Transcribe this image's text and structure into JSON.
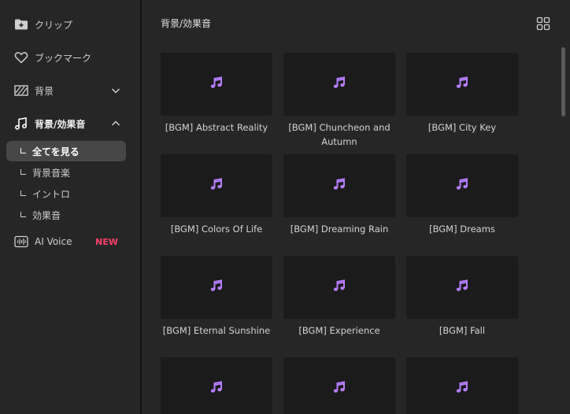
{
  "sidebar": {
    "items": [
      {
        "label": "クリップ",
        "icon": "folder-plus-icon"
      },
      {
        "label": "ブックマーク",
        "icon": "heart-icon"
      },
      {
        "label": "背景",
        "icon": "stripes-icon"
      },
      {
        "label": "背景/効果音",
        "icon": "music-note-icon"
      }
    ],
    "subitems": [
      {
        "label": "全てを見る",
        "active": true
      },
      {
        "label": "背景音楽",
        "active": false
      },
      {
        "label": "イントロ",
        "active": false
      },
      {
        "label": "効果音",
        "active": false
      }
    ],
    "ai_voice": {
      "label": "AI Voice",
      "badge": "NEW",
      "icon": "waveform-icon"
    }
  },
  "main": {
    "title": "背景/効果音",
    "cards": [
      {
        "label": "[BGM] Abstract Reality"
      },
      {
        "label": "[BGM] Chuncheon and Autumn"
      },
      {
        "label": "[BGM] City Key"
      },
      {
        "label": "[BGM] Colors Of Life"
      },
      {
        "label": "[BGM] Dreaming Rain"
      },
      {
        "label": "[BGM] Dreams"
      },
      {
        "label": "[BGM] Eternal Sunshine"
      },
      {
        "label": "[BGM] Experience"
      },
      {
        "label": "[BGM] Fall"
      },
      {
        "label": ""
      },
      {
        "label": ""
      },
      {
        "label": ""
      }
    ]
  },
  "colors": {
    "background": "#262626",
    "thumbnail": "#1b1b1b",
    "accent_note": "#b77dff",
    "active_item": "#474747",
    "new_badge": "#ff3f6a"
  }
}
